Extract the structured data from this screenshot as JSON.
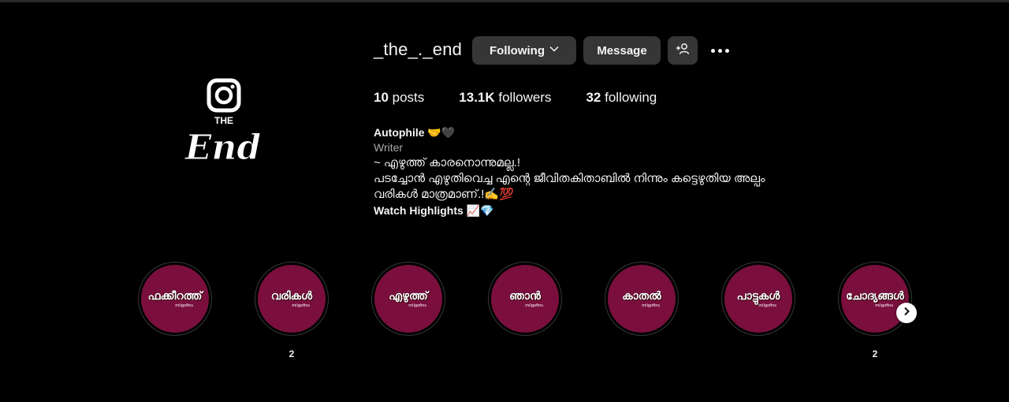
{
  "profile": {
    "username": "_the_._end",
    "following_label": "Following",
    "message_label": "Message",
    "stats": {
      "posts_count": "10",
      "posts_label": " posts",
      "followers_count": "13.1K",
      "followers_label": " followers",
      "following_count": "32",
      "following_label": " following"
    },
    "bio": {
      "name": "Autophile 🤝🖤",
      "category": "Writer",
      "lines": [
        "~ എഴുത്ത് കാരനൊന്നുമല്ല.!",
        "പടച്ചോൻ എഴുതിവെച്ച എന്റെ ജീവിതകിതാബിൽ നിന്നും കട്ടെഴുതിയ അല്പം",
        "വരികൾ മാത്രമാണ്.!✍️💯"
      ],
      "highlights_text": "Watch Highlights 📈💎"
    },
    "avatar_text": "THE End"
  },
  "highlights": [
    {
      "title": "ഫക്കീറത്ത്",
      "sub": "milgofins",
      "label": ""
    },
    {
      "title": "വരികൾ",
      "sub": "milgofins",
      "label": "2"
    },
    {
      "title": "എഴുത്ത്",
      "sub": "milgofins",
      "label": ""
    },
    {
      "title": "ഞാൻ",
      "sub": "milgofins",
      "label": ""
    },
    {
      "title": "കാതൽ",
      "sub": "milgofins",
      "label": ""
    },
    {
      "title": "പാട്ടുകൾ",
      "sub": "milgofins",
      "label": ""
    },
    {
      "title": "ചോദ്യങ്ങൾ",
      "sub": "milgofins",
      "label": "2"
    }
  ],
  "colors": {
    "background": "#000000",
    "button": "#363636",
    "highlight_fill": "#7a0f3e"
  },
  "icons": {
    "more": "more-horizontal-icon",
    "add_user": "add-user-icon",
    "next": "chevron-right-icon",
    "dropdown": "chevron-down-icon",
    "avatar_logo": "instagram-logo-icon"
  }
}
